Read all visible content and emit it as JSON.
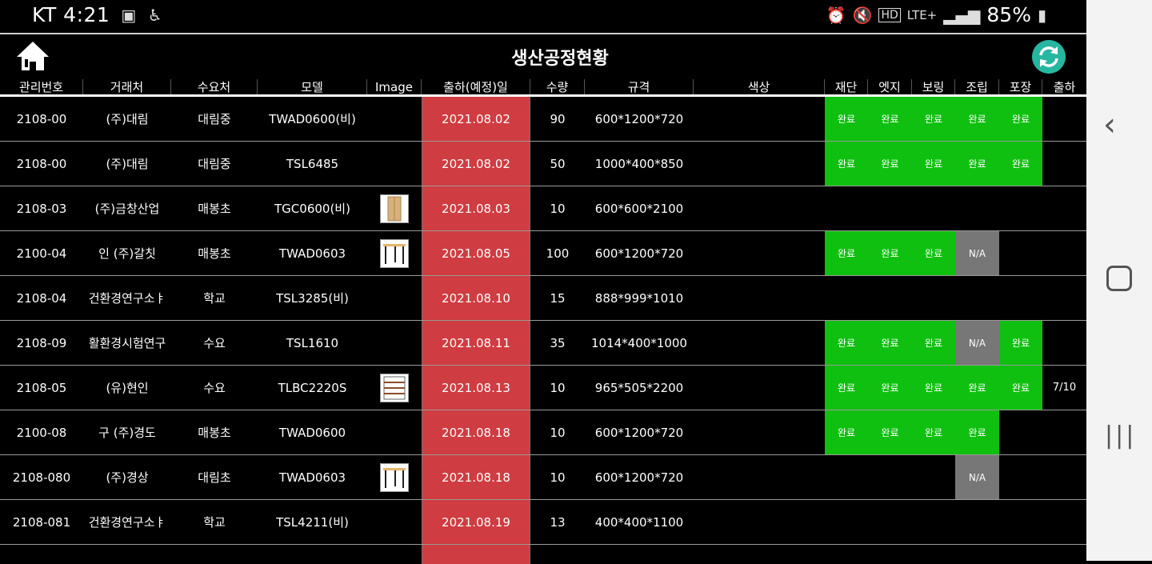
{
  "status_bar": {
    "carrier_time": "KT 4:21",
    "network": "LTE+",
    "battery": "85%",
    "left_icons": [
      "image-icon",
      "accessibility-icon"
    ],
    "right_icons": [
      "alarm-icon",
      "mute-icon",
      "hd-voice-icon",
      "signal-icon",
      "battery-icon"
    ]
  },
  "header": {
    "title": "생산공정현황"
  },
  "table": {
    "columns": [
      "관리번호",
      "거래처",
      "수요처",
      "모델",
      "Image",
      "출하(예정)일",
      "수량",
      "규격",
      "색상",
      "재단",
      "엣지",
      "보링",
      "조립",
      "포장",
      "출하"
    ],
    "rows": [
      {
        "id": "2108-00",
        "client": "(주)대림",
        "demand": "대림중",
        "model": "TWAD0600(비)",
        "image": false,
        "date": "2021.08.02",
        "qty": "90",
        "spec": "600*1200*720",
        "color": "",
        "s": [
          "완료",
          "완료",
          "완료",
          "완료",
          "완료"
        ],
        "ship": ""
      },
      {
        "id": "2108-00",
        "client": "(주)대림",
        "demand": "대림중",
        "model": "TSL6485",
        "image": false,
        "date": "2021.08.02",
        "qty": "50",
        "spec": "1000*400*850",
        "color": "",
        "s": [
          "완료",
          "완료",
          "완료",
          "완료",
          "완료"
        ],
        "ship": ""
      },
      {
        "id": "2108-03",
        "client": "(주)금창산업",
        "demand": "매봉초",
        "model": "TGC0600(비)",
        "image": "cabinet",
        "date": "2021.08.03",
        "qty": "10",
        "spec": "600*600*2100",
        "color": "",
        "s": [
          "",
          "",
          "",
          "",
          ""
        ],
        "ship": ""
      },
      {
        "id": "2100-04",
        "client": "인      (주)갈칫",
        "demand": "매봉초",
        "model": "TWAD0603",
        "image": "desk",
        "date": "2021.08.05",
        "qty": "100",
        "spec": "600*1200*720",
        "color": "",
        "s": [
          "완료",
          "완료",
          "완료",
          "N/A",
          ""
        ],
        "ship": ""
      },
      {
        "id": "2108-04",
        "client": "건환경연구소ㅑ",
        "demand": "학교",
        "model": "TSL3285(비)",
        "image": false,
        "date": "2021.08.10",
        "qty": "15",
        "spec": "888*999*1010",
        "color": "",
        "s": [
          "",
          "",
          "",
          "",
          ""
        ],
        "ship": ""
      },
      {
        "id": "2108-09",
        "client": "활환경시험연구",
        "demand": "수요",
        "model": "TSL1610",
        "image": false,
        "date": "2021.08.11",
        "qty": "35",
        "spec": "1014*400*1000",
        "color": "",
        "s": [
          "완료",
          "완료",
          "완료",
          "N/A",
          "완료"
        ],
        "ship": ""
      },
      {
        "id": "2108-05",
        "client": "(유)현인",
        "demand": "수요",
        "model": "TLBC2220S",
        "image": "shelf",
        "date": "2021.08.13",
        "qty": "10",
        "spec": "965*505*2200",
        "color": "",
        "s": [
          "완료",
          "완료",
          "완료",
          "완료",
          "완료"
        ],
        "ship": "7/10"
      },
      {
        "id": "2100-08",
        "client": "구      (주)경도",
        "demand": "매봉초",
        "model": "TWAD0600",
        "image": false,
        "date": "2021.08.18",
        "qty": "10",
        "spec": "600*1200*720",
        "color": "",
        "s": [
          "완료",
          "완료",
          "완료",
          "완료",
          ""
        ],
        "ship": ""
      },
      {
        "id": "2108-080",
        "client": "(주)경상",
        "demand": "대림초",
        "model": "TWAD0603",
        "image": "desk",
        "date": "2021.08.18",
        "qty": "10",
        "spec": "600*1200*720",
        "color": "",
        "s": [
          "",
          "",
          "",
          "N/A",
          ""
        ],
        "ship": ""
      },
      {
        "id": "2108-081",
        "client": "건환경연구소ㅑ",
        "demand": "학교",
        "model": "TSL4211(비)",
        "image": false,
        "date": "2021.08.19",
        "qty": "13",
        "spec": "400*400*1100",
        "color": "",
        "s": [
          "",
          "",
          "",
          "",
          ""
        ],
        "ship": ""
      }
    ]
  },
  "colors": {
    "date_bg": "#cf3c41",
    "done_bg": "#10c010",
    "na_bg": "#777777",
    "refresh_bg": "#27b6a0"
  },
  "nav": {
    "back_icon": "back-icon",
    "home_icon": "home-nav-icon",
    "recent_icon": "recent-apps-icon"
  }
}
